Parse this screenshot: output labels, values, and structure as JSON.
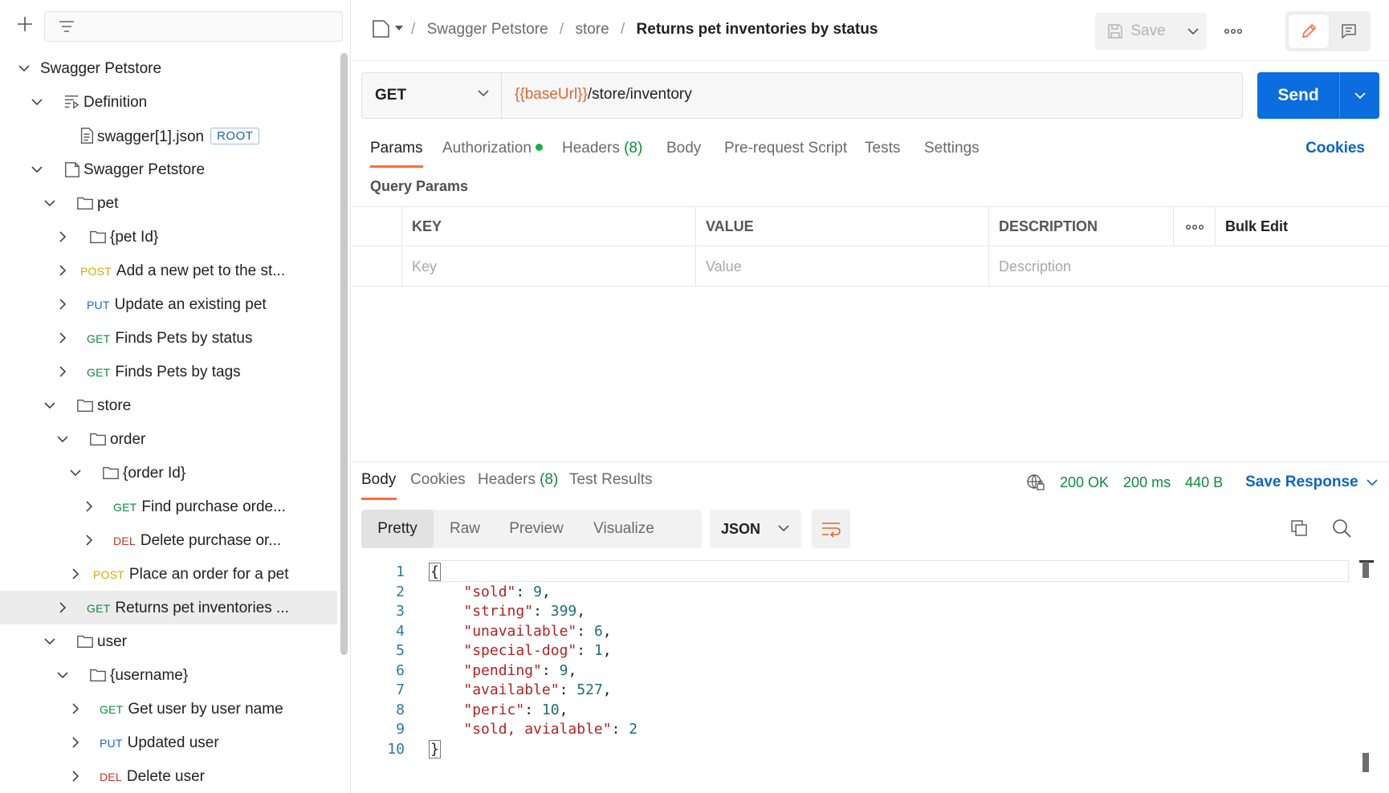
{
  "sidebar": {
    "tree": [
      {
        "label": "Swagger Petstore",
        "type": "collection"
      },
      {
        "label": "Definition",
        "type": "definition"
      },
      {
        "label": "swagger[1].json",
        "type": "file",
        "badge": "ROOT"
      },
      {
        "label": "Swagger Petstore",
        "type": "collection-doc"
      },
      {
        "label": "pet",
        "type": "folder"
      },
      {
        "label": "{pet Id}",
        "type": "folder"
      },
      {
        "label": "Add a new pet to the st...",
        "method": "POST"
      },
      {
        "label": "Update an existing pet",
        "method": "PUT"
      },
      {
        "label": "Finds Pets by status",
        "method": "GET"
      },
      {
        "label": "Finds Pets by tags",
        "method": "GET"
      },
      {
        "label": "store",
        "type": "folder"
      },
      {
        "label": "order",
        "type": "folder"
      },
      {
        "label": "{order Id}",
        "type": "folder"
      },
      {
        "label": "Find purchase orde...",
        "method": "GET"
      },
      {
        "label": "Delete purchase or...",
        "method": "DEL"
      },
      {
        "label": "Place an order for a pet",
        "method": "POST"
      },
      {
        "label": "Returns pet inventories ...",
        "method": "GET",
        "selected": true
      },
      {
        "label": "user",
        "type": "folder"
      },
      {
        "label": "{username}",
        "type": "folder"
      },
      {
        "label": "Get user by user name",
        "method": "GET"
      },
      {
        "label": "Updated user",
        "method": "PUT"
      },
      {
        "label": "Delete user",
        "method": "DEL"
      }
    ]
  },
  "header": {
    "breadcrumb": [
      "Swagger Petstore",
      "store"
    ],
    "separator": "/",
    "current": "Returns pet inventories by status",
    "save_label": "Save"
  },
  "request": {
    "method": "GET",
    "url_var": "{{baseUrl}}",
    "url_path": "/store/inventory",
    "send_label": "Send",
    "tabs": {
      "params": "Params",
      "authorization": "Authorization",
      "headers": "Headers",
      "headers_count": "(8)",
      "body": "Body",
      "prerequest": "Pre-request Script",
      "tests": "Tests",
      "settings": "Settings"
    },
    "cookies_label": "Cookies",
    "query_title": "Query Params",
    "table": {
      "headers": [
        "KEY",
        "VALUE",
        "DESCRIPTION"
      ],
      "bulk_edit": "Bulk Edit",
      "placeholders": [
        "Key",
        "Value",
        "Description"
      ]
    }
  },
  "response": {
    "tabs": {
      "body": "Body",
      "cookies": "Cookies",
      "headers": "Headers",
      "headers_count": "(8)",
      "test_results": "Test Results"
    },
    "status": "200 OK",
    "time": "200 ms",
    "size": "440 B",
    "save_response": "Save Response",
    "view_modes": [
      "Pretty",
      "Raw",
      "Preview",
      "Visualize"
    ],
    "format": "JSON",
    "code_lines": [
      {
        "n": "1",
        "kind": "open",
        "text": "{"
      },
      {
        "n": "2",
        "key": "\"sold\"",
        "value": "9",
        "comma": ","
      },
      {
        "n": "3",
        "key": "\"string\"",
        "value": "399",
        "comma": ","
      },
      {
        "n": "4",
        "key": "\"unavailable\"",
        "value": "6",
        "comma": ","
      },
      {
        "n": "5",
        "key": "\"special-dog\"",
        "value": "1",
        "comma": ","
      },
      {
        "n": "6",
        "key": "\"pending\"",
        "value": "9",
        "comma": ","
      },
      {
        "n": "7",
        "key": "\"available\"",
        "value": "527",
        "comma": ","
      },
      {
        "n": "8",
        "key": "\"peric\"",
        "value": "10",
        "comma": ","
      },
      {
        "n": "9",
        "key": "\"sold, avialable\"",
        "value": "2",
        "comma": ""
      },
      {
        "n": "10",
        "kind": "close",
        "text": "}"
      }
    ]
  },
  "colors": {
    "accent": "#ff6c37",
    "send": "#0b6de0",
    "get": "#0f8a3c",
    "post": "#d9a800",
    "put": "#1d63c9",
    "del": "#c5372c",
    "variable": "#e0662d"
  }
}
